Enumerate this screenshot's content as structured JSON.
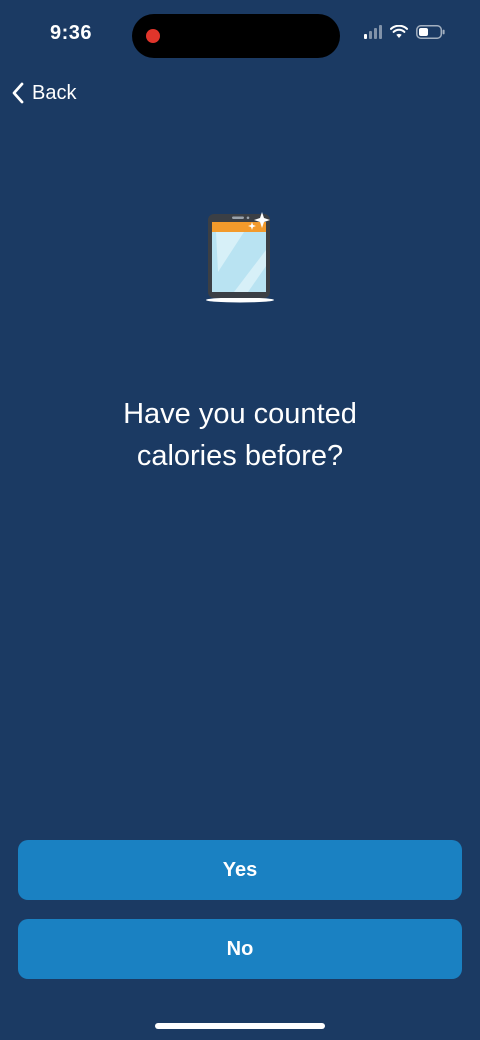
{
  "status_bar": {
    "time": "9:36",
    "recording_color": "#e0352b",
    "icons": [
      "cellular-signal-icon",
      "wifi-icon",
      "battery-icon"
    ]
  },
  "nav": {
    "back_label": "Back",
    "back_icon": "chevron-left-icon"
  },
  "illustration": {
    "icon": "phone-app-icon"
  },
  "question": {
    "line1": "Have you counted",
    "line2": "calories before?"
  },
  "buttons": {
    "yes_label": "Yes",
    "no_label": "No"
  },
  "colors": {
    "background": "#1b3a63",
    "button": "#1a81c2",
    "accent_orange": "#f39a2b"
  }
}
